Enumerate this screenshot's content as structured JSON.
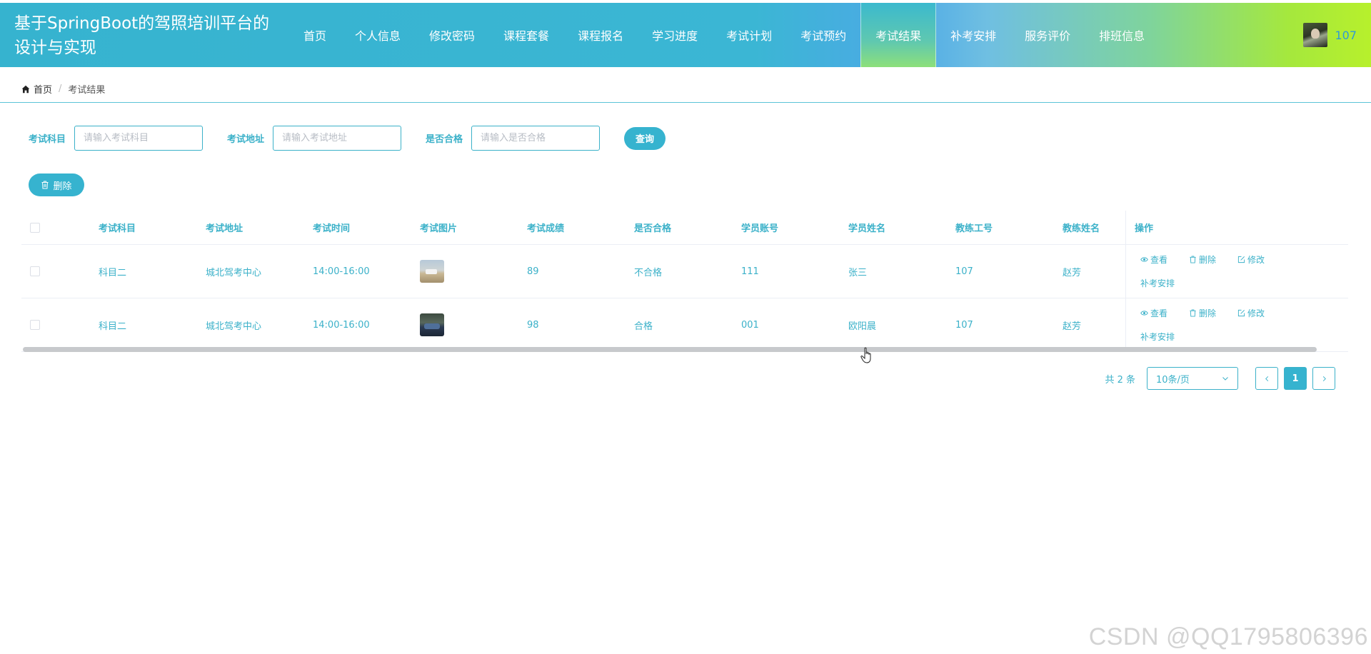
{
  "header": {
    "site_title": "基于SpringBoot的驾照培训平台的设计与实现",
    "nav": [
      "首页",
      "个人信息",
      "修改密码",
      "课程套餐",
      "课程报名",
      "学习进度",
      "考试计划",
      "考试预约",
      "考试结果",
      "补考安排",
      "服务评价",
      "排班信息"
    ],
    "active_nav": "考试结果",
    "user_name": "107"
  },
  "breadcrumb": {
    "home": "首页",
    "separator": "/",
    "current": "考试结果"
  },
  "search": {
    "fields": [
      {
        "label": "考试科目",
        "placeholder": "请输入考试科目",
        "value": ""
      },
      {
        "label": "考试地址",
        "placeholder": "请输入考试地址",
        "value": ""
      },
      {
        "label": "是否合格",
        "placeholder": "请输入是否合格",
        "value": ""
      }
    ],
    "query_label": "查询"
  },
  "toolbar": {
    "delete_label": "删除"
  },
  "table": {
    "columns": [
      "考试科目",
      "考试地址",
      "考试时间",
      "考试图片",
      "考试成绩",
      "是否合格",
      "学员账号",
      "学员姓名",
      "教练工号",
      "教练姓名"
    ],
    "ops_header": "操作",
    "rows": [
      {
        "subject": "科目二",
        "address": "城北驾考中心",
        "time": "14:00-16:00",
        "image": "exam-photo",
        "score": "89",
        "passed": "不合格",
        "student_account": "111",
        "student_name": "张三",
        "coach_id": "107",
        "coach_name": "赵芳"
      },
      {
        "subject": "科目二",
        "address": "城北驾考中心",
        "time": "14:00-16:00",
        "image": "exam-photo",
        "score": "98",
        "passed": "合格",
        "student_account": "001",
        "student_name": "欧阳晨",
        "coach_id": "107",
        "coach_name": "赵芳"
      }
    ],
    "row_actions": {
      "view": "查看",
      "delete": "删除",
      "edit": "修改",
      "makeup": "补考安排"
    }
  },
  "pagination": {
    "total": "共 2 条",
    "page_size": "10条/页",
    "current_page": "1"
  },
  "watermark": "CSDN @QQ1795806396",
  "colors": {
    "accent": "#36b3cf",
    "text_accent": "#3bb1c9"
  }
}
